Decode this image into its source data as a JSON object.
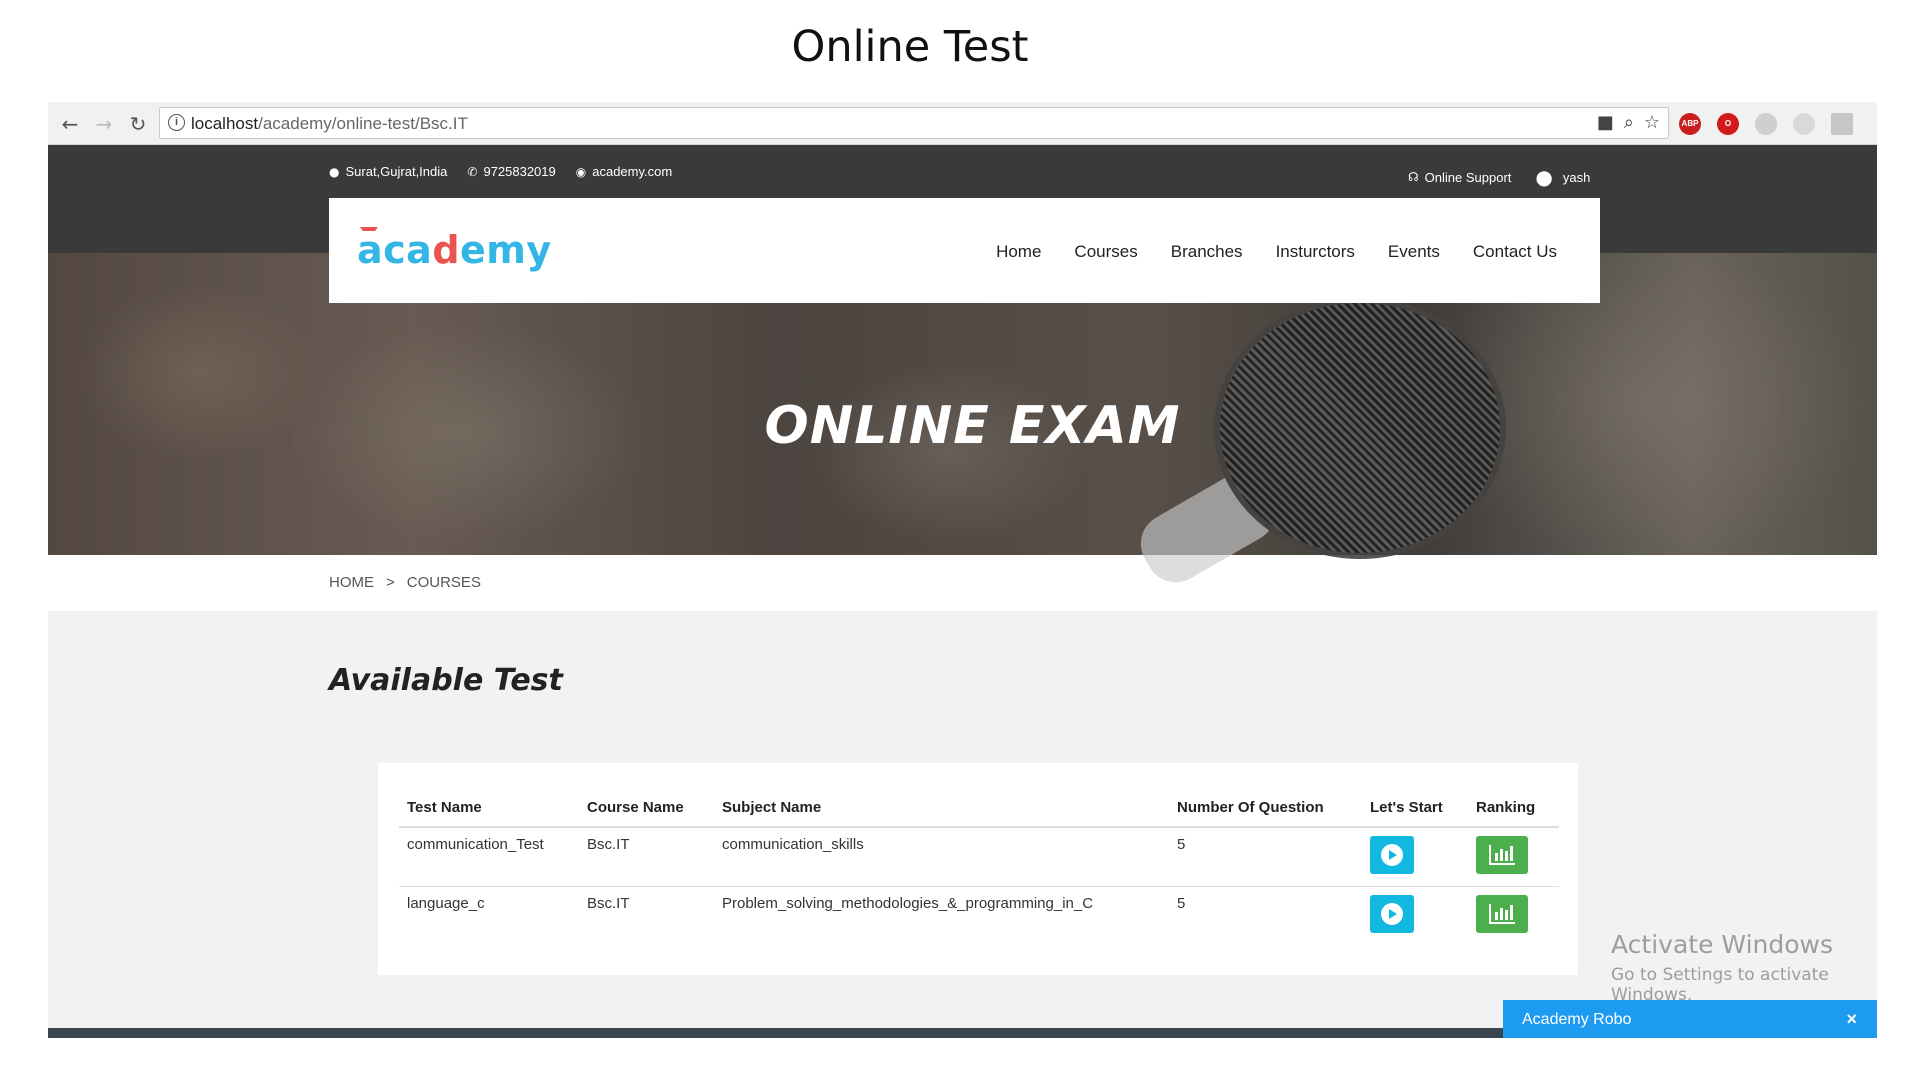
{
  "slide_title": "Online Test",
  "browser": {
    "url_host": "localhost",
    "url_path": "/academy/online-test/Bsc.IT"
  },
  "topbar": {
    "location": "Surat,Gujrat,India",
    "phone": "9725832019",
    "website": "academy.com",
    "support": "Online Support",
    "user": "yash"
  },
  "logo": {
    "part1": "aca",
    "part2": "d",
    "part3": "emy"
  },
  "nav": [
    "Home",
    "Courses",
    "Branches",
    "Insturctors",
    "Events",
    "Contact Us"
  ],
  "hero": {
    "title": "ONLINE EXAM"
  },
  "breadcrumb": {
    "home": "HOME",
    "sep": ">",
    "current": "COURSES"
  },
  "section": {
    "title": "Available Test"
  },
  "table": {
    "headers": [
      "Test Name",
      "Course Name",
      "Subject Name",
      "Number Of Question",
      "Let's Start",
      "Ranking"
    ],
    "rows": [
      {
        "test": "communication_Test",
        "course": "Bsc.IT",
        "subject": "communication_skills",
        "questions": "5"
      },
      {
        "test": "language_c",
        "course": "Bsc.IT",
        "subject": "Problem_solving_methodologies_&_programming_in_C",
        "questions": "5"
      }
    ]
  },
  "watermark": {
    "line1": "Activate Windows",
    "line2": "Go to Settings to activate Windows."
  },
  "chat": {
    "label": "Academy Robo",
    "close": "×"
  },
  "colors": {
    "accent": "#33b5e5",
    "start_button": "#11b9e0",
    "ranking_button": "#4cae4c",
    "chat": "#1d9bf0"
  }
}
